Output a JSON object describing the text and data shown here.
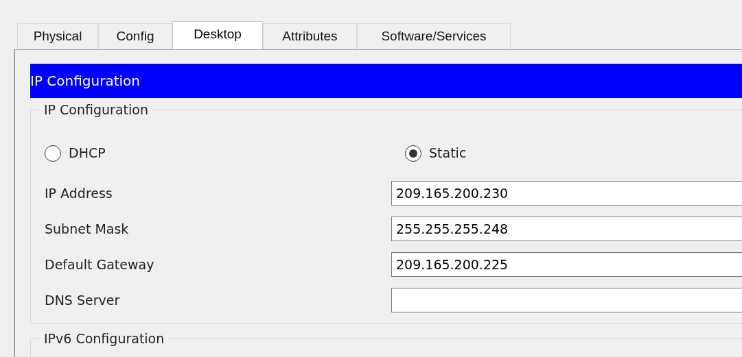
{
  "tabs": [
    {
      "label": "Physical",
      "selected": false
    },
    {
      "label": "Config",
      "selected": false
    },
    {
      "label": "Desktop",
      "selected": true
    },
    {
      "label": "Attributes",
      "selected": false
    },
    {
      "label": "Software/Services",
      "selected": false
    }
  ],
  "header": "IP Configuration",
  "ip_configuration": {
    "legend": "IP Configuration",
    "modes": [
      {
        "label": "DHCP",
        "selected": false
      },
      {
        "label": "Static",
        "selected": true
      }
    ],
    "fields": [
      {
        "label": "IP Address",
        "value": "209.165.200.230"
      },
      {
        "label": "Subnet Mask",
        "value": "255.255.255.248"
      },
      {
        "label": "Default Gateway",
        "value": "209.165.200.225"
      },
      {
        "label": "DNS Server"
      }
    ]
  },
  "ipv6_configuration": {
    "legend": "IPv6 Configuration"
  }
}
